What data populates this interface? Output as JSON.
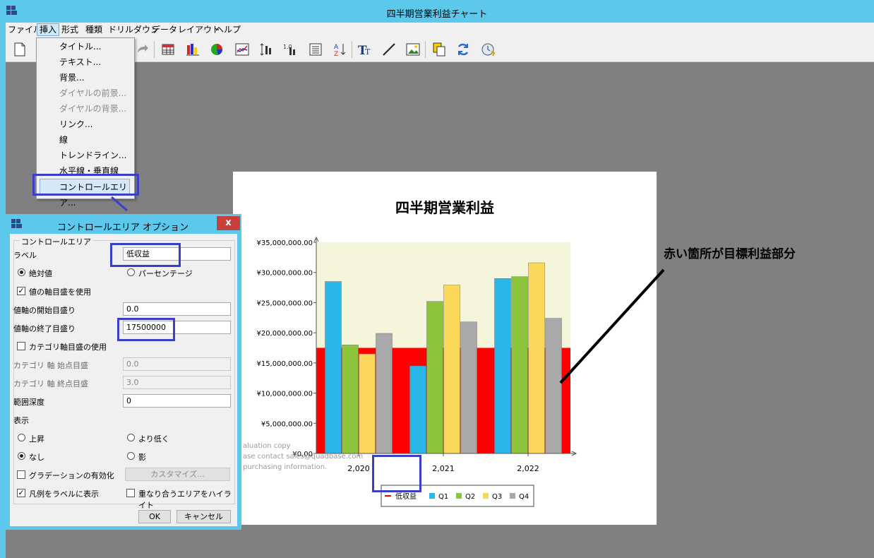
{
  "window": {
    "title": "四半期営業利益チャート"
  },
  "menubar": {
    "items": [
      "ファイル",
      "挿入",
      "形式",
      "種類",
      "ドリルダウン",
      "データ",
      "レイアウト",
      "ヘルプ"
    ]
  },
  "insert_menu": {
    "items": [
      {
        "label": "タイトル...",
        "enabled": true
      },
      {
        "label": "テキスト...",
        "enabled": true
      },
      {
        "label": "背景...",
        "enabled": true
      },
      {
        "label": "ダイヤルの前景...",
        "enabled": false
      },
      {
        "label": "ダイヤルの背景...",
        "enabled": false
      },
      {
        "label": "リンク...",
        "enabled": true
      },
      {
        "label": "線",
        "enabled": true
      },
      {
        "label": "トレンドライン...",
        "enabled": true
      },
      {
        "label": "水平線・垂直線",
        "enabled": true
      },
      {
        "label": "コントロールエリア...",
        "enabled": true,
        "highlighted": true
      }
    ]
  },
  "dialog": {
    "title": "コントロールエリア オプション",
    "close_label": "x",
    "group_title": "コントロールエリア",
    "label_caption": "ラベル",
    "label_value": "低収益",
    "radio_absolute": "絶対値",
    "radio_percentage": "パーセンテージ",
    "value_mode": "absolute",
    "use_value_axis_scale_label": "値の軸目盛を使用",
    "use_value_axis_scale": true,
    "value_axis_start_label": "値軸の開始目盛り",
    "value_axis_start": "0.0",
    "value_axis_end_label": "値軸の終了目盛り",
    "value_axis_end": "17500000",
    "use_category_axis_label": "カテゴリ軸目盛の使用",
    "use_category_axis": false,
    "category_start_label": "カテゴリ 軸 始点目盛",
    "category_start": "0.0",
    "category_end_label": "カテゴリ 軸 終点目盛",
    "category_end": "3.0",
    "range_depth_label": "範囲深度",
    "range_depth": "0",
    "display_label": "表示",
    "display_up": "上昇",
    "display_lower": "より低く",
    "display_none": "なし",
    "display_shadow": "影",
    "display_mode": "none",
    "gradient_label": "グラデーションの有効化",
    "gradient": false,
    "customize_label": "カスタマイズ...",
    "legend_as_label": "凡例をラベルに表示",
    "legend_as_label_checked": true,
    "highlight_overlap": "重なり合うエリアをハイライト",
    "highlight_overlap_checked": false,
    "ok_label": "OK",
    "cancel_label": "キャンセル"
  },
  "annotation": {
    "text": "赤い箇所が目標利益部分"
  },
  "chart_data": {
    "type": "bar",
    "title": "四半期営業利益",
    "categories": [
      "2,020",
      "2,021",
      "2,022"
    ],
    "series": [
      {
        "name": "Q1",
        "color": "#29b6e8",
        "values": [
          28500000,
          14500000,
          29000000
        ]
      },
      {
        "name": "Q2",
        "color": "#8cc43c",
        "values": [
          18000000,
          25200000,
          29300000
        ]
      },
      {
        "name": "Q3",
        "color": "#f9d85a",
        "values": [
          16500000,
          27900000,
          31600000
        ]
      },
      {
        "name": "Q4",
        "color": "#a9a9a9",
        "values": [
          19900000,
          21800000,
          22400000
        ]
      }
    ],
    "ylim": [
      0,
      35000000
    ],
    "yticks": [
      "¥0.00",
      "¥5,000,000.00",
      "¥10,000,000.00",
      "¥15,000,000.00",
      "¥20,000,000.00",
      "¥25,000,000.00",
      "¥30,000,000.00",
      "¥35,000,000.00"
    ],
    "ytick_values": [
      0,
      5000000,
      10000000,
      15000000,
      20000000,
      25000000,
      30000000,
      35000000
    ],
    "control_area": {
      "label": "低収益",
      "color": "#ff0000",
      "from": 0,
      "to": 17500000
    },
    "plot_background": "#f5f5dc",
    "legend": [
      "低収益",
      "Q1",
      "Q2",
      "Q3",
      "Q4"
    ],
    "legend_position": "bottom",
    "watermark": [
      "aluation copy",
      "ase contact sales@quadbase.com",
      "purchasing information."
    ]
  }
}
